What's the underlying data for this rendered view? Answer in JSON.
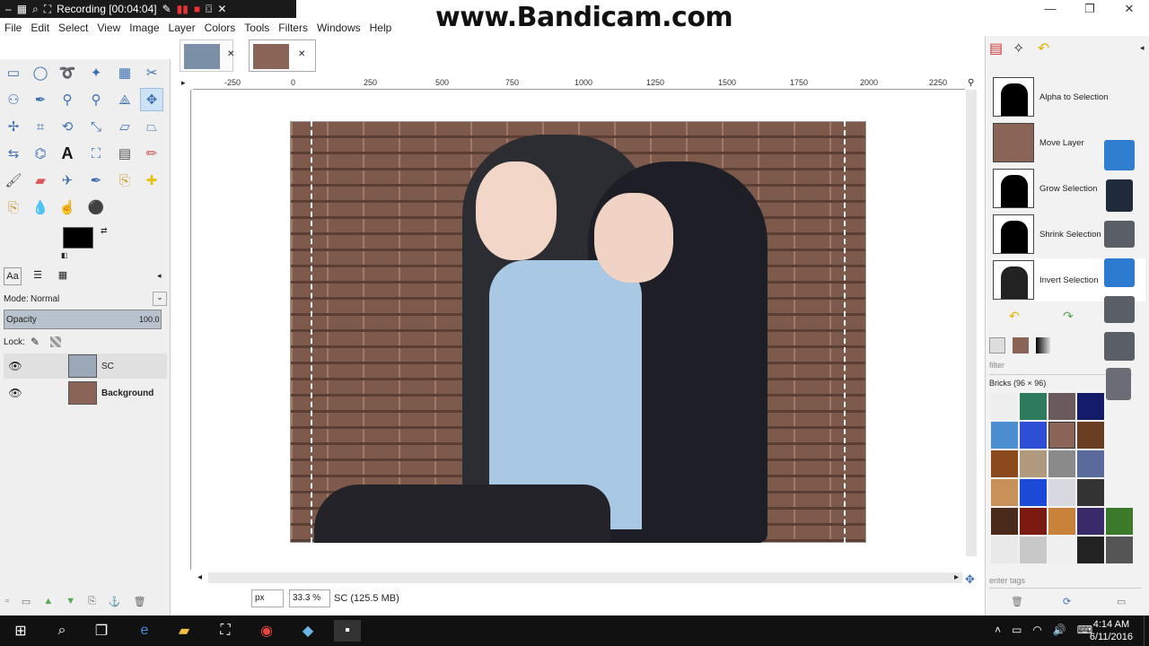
{
  "recorder": {
    "title": "Recording [00:04:04]"
  },
  "watermark": "www.Bandicam.com",
  "menu": [
    "File",
    "Edit",
    "Select",
    "View",
    "Image",
    "Layer",
    "Colors",
    "Tools",
    "Filters",
    "Windows",
    "Help"
  ],
  "ruler": [
    "-250",
    "0",
    "250",
    "500",
    "750",
    "1000",
    "1250",
    "1500",
    "1750",
    "2000",
    "2250"
  ],
  "layers": {
    "mode_label": "Mode:",
    "mode_value": "Normal",
    "opacity_label": "Opacity",
    "opacity_value": "100.0",
    "lock_label": "Lock:",
    "items": [
      {
        "name": "SC"
      },
      {
        "name": "Background"
      }
    ]
  },
  "status": {
    "unit": "px",
    "zoom": "33.3 %",
    "info": "SC (125.5 MB)"
  },
  "undo_history": [
    "Alpha to Selection",
    "Move Layer",
    "Grow Selection",
    "Shrink Selection",
    "Invert Selection"
  ],
  "patterns": {
    "filter_placeholder": "filter",
    "current": "Bricks (96 × 96)",
    "tags_placeholder": "enter tags"
  },
  "clock": {
    "time": "4:14 AM",
    "date": "6/11/2016"
  },
  "colors": {
    "accent": "#3b6fb3",
    "selection": "#cfe3f6"
  }
}
